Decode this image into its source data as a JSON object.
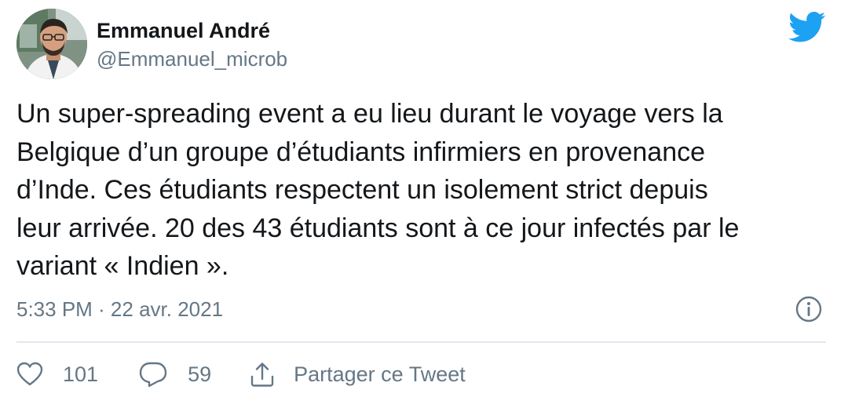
{
  "author": {
    "name": "Emmanuel André",
    "handle": "@Emmanuel_microb",
    "avatar_icon": "avatar"
  },
  "brand": {
    "logo_icon": "twitter-bird-icon",
    "color": "#1da1f2"
  },
  "tweet": {
    "text": "Un super-spreading event a eu lieu durant le voyage vers la\nBelgique d’un groupe d’étudiants infirmiers en provenance\nd’Inde. Ces étudiants respectent un isolement strict depuis\nleur arrivée. 20 des 43 étudiants sont à ce jour infectés par le\nvariant « Indien ».",
    "timestamp": "5:33 PM · 22 avr. 2021",
    "info_icon": "info-icon"
  },
  "actions": {
    "likes": "101",
    "replies": "59",
    "share_label": "Partager ce Tweet",
    "like_icon": "heart-icon",
    "reply_icon": "reply-bubble-icon",
    "share_icon": "share-icon"
  },
  "colors": {
    "text": "#14171a",
    "secondary": "#657786",
    "divider": "#e1e8ed"
  }
}
